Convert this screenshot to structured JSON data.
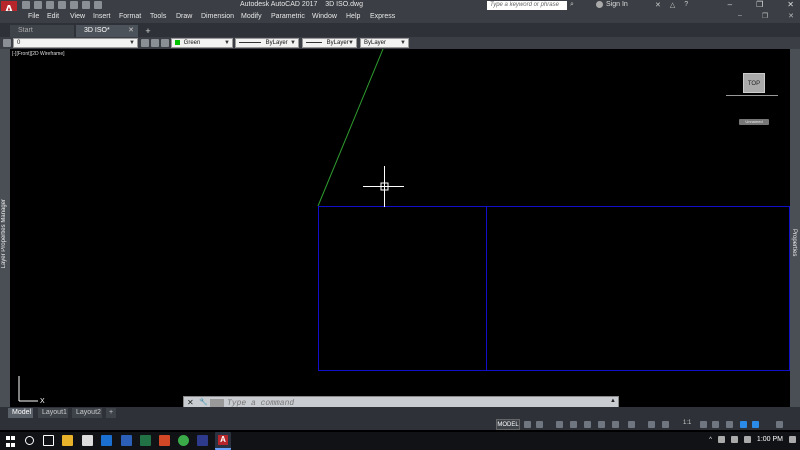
{
  "app": {
    "logo_letter": "A",
    "title": "Autodesk AutoCAD 2017    3D ISO.dwg",
    "search_placeholder": "Type a keyword or phrase",
    "sign_in_label": "Sign In"
  },
  "menu": {
    "items": [
      "File",
      "Edit",
      "View",
      "Insert",
      "Format",
      "Tools",
      "Draw",
      "Dimension",
      "Modify",
      "Parametric",
      "Window",
      "Help",
      "Express"
    ]
  },
  "tabs": {
    "start": "Start",
    "file": "3D ISO*",
    "add": "+"
  },
  "properties": {
    "layer_value": "0",
    "color_value": "Green",
    "linetype_value": "ByLayer",
    "lineweight_value": "ByLayer",
    "plotstyle_value": "ByLayer"
  },
  "viewport": {
    "label": "[-][Front][2D Wireframe]",
    "viewcube_face": "TOP",
    "ucs_button": "Unnamed",
    "left_palette": "Layer Properties Manager",
    "right_palette": "Properties",
    "colors": {
      "line_green": "#2e9b2e",
      "line_blue": "#1010c8",
      "crosshair": "#ffffff"
    }
  },
  "layouts": {
    "tabs": [
      "Model",
      "Layout1",
      "Layout2"
    ],
    "add": "+"
  },
  "command": {
    "placeholder": "Type a command"
  },
  "status": {
    "model": "MODEL",
    "scale": "1:1"
  },
  "taskbar": {
    "clock": "1:00 PM"
  }
}
